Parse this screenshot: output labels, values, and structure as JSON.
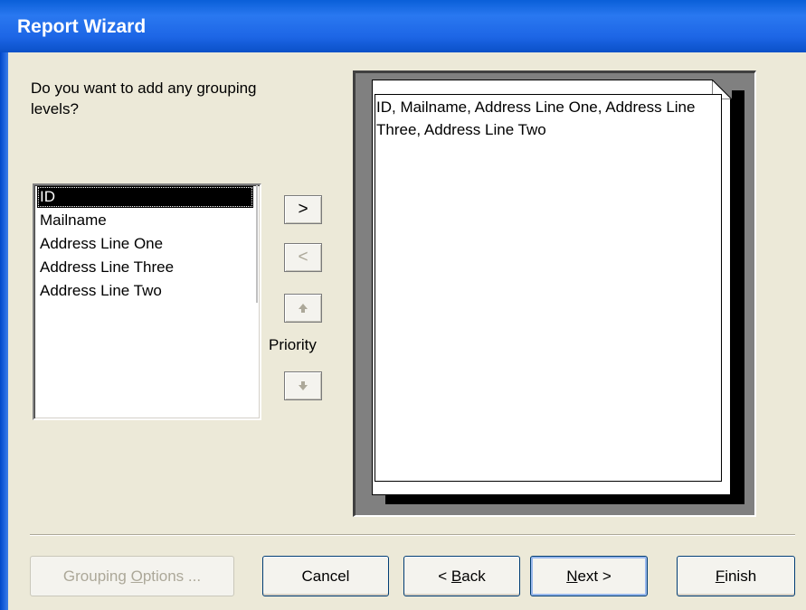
{
  "window": {
    "title": "Report Wizard"
  },
  "question": "Do you want to add any grouping\nlevels?",
  "fields": [
    {
      "label": "ID",
      "selected": true
    },
    {
      "label": "Mailname",
      "selected": false
    },
    {
      "label": "Address Line One",
      "selected": false
    },
    {
      "label": "Address Line Three",
      "selected": false
    },
    {
      "label": "Address Line Two",
      "selected": false
    }
  ],
  "side_buttons": {
    "add": {
      "label": ">",
      "enabled": true
    },
    "remove": {
      "label": "<",
      "enabled": false
    },
    "priority_up": {
      "icon": "up-arrow-icon",
      "label": "▲",
      "enabled": false
    },
    "priority_down": {
      "icon": "down-arrow-icon",
      "label": "▼",
      "enabled": false
    },
    "priority_label": "Priority"
  },
  "preview": {
    "text": "ID, Mailname, Address Line One, Address Line Three, Address Line Two"
  },
  "buttons": {
    "grouping_options": {
      "pre": "Grouping ",
      "mn": "O",
      "post": "ptions ...",
      "enabled": false
    },
    "cancel": {
      "pre": "Cancel",
      "mn": "",
      "post": "",
      "enabled": true
    },
    "back": {
      "pre": "< ",
      "mn": "B",
      "post": "ack",
      "enabled": true
    },
    "next": {
      "pre": "",
      "mn": "N",
      "post": "ext >",
      "enabled": true,
      "default": true
    },
    "finish": {
      "pre": "",
      "mn": "F",
      "post": "inish",
      "enabled": true
    }
  }
}
